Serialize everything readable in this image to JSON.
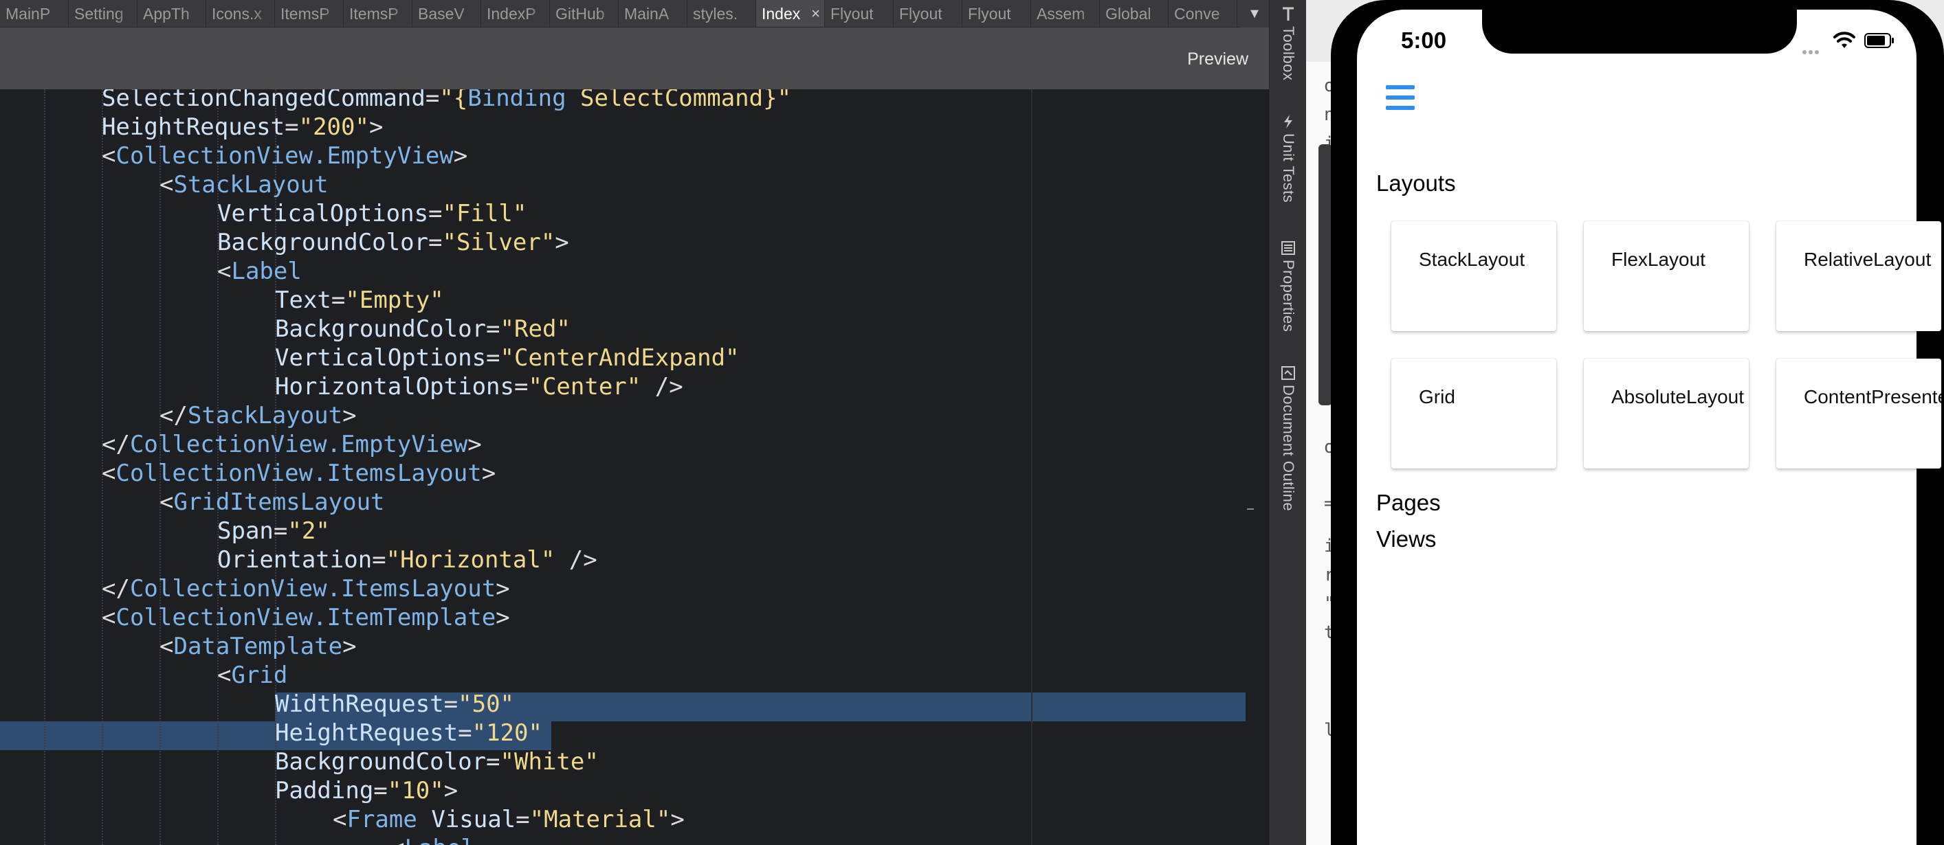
{
  "tabs": [
    {
      "label": "MainP",
      "active": false
    },
    {
      "label": "Setting",
      "active": false
    },
    {
      "label": "AppTh",
      "active": false
    },
    {
      "label": "Icons.x",
      "active": false
    },
    {
      "label": "ItemsP",
      "active": false
    },
    {
      "label": "ItemsP",
      "active": false
    },
    {
      "label": "BaseV",
      "active": false
    },
    {
      "label": "IndexP",
      "active": false
    },
    {
      "label": "GitHub",
      "active": false
    },
    {
      "label": "MainA",
      "active": false
    },
    {
      "label": "styles.",
      "active": false
    },
    {
      "label": "Index",
      "active": true
    },
    {
      "label": "Flyout",
      "active": false
    },
    {
      "label": "Flyout",
      "active": false
    },
    {
      "label": "Flyout",
      "active": false
    },
    {
      "label": "Assem",
      "active": false
    },
    {
      "label": "Global",
      "active": false
    },
    {
      "label": "Conve",
      "active": false
    }
  ],
  "tab_overflow_icon": "chevron-down-icon",
  "toolbar": {
    "preview_label": "Preview"
  },
  "code_lines": [
    [
      {
        "k": "a",
        "t": "SelectionChangedCommand"
      },
      {
        "k": "p",
        "t": "="
      },
      {
        "k": "s",
        "t": "\"{"
      },
      {
        "k": "t",
        "t": "Binding"
      },
      {
        "k": "s",
        "t": " SelectCommand}\""
      }
    ],
    [
      {
        "k": "a",
        "t": "HeightRequest"
      },
      {
        "k": "p",
        "t": "="
      },
      {
        "k": "s",
        "t": "\"200\""
      },
      {
        "k": "p",
        "t": ">"
      }
    ],
    [
      {
        "k": "p",
        "t": "<"
      },
      {
        "k": "t",
        "t": "CollectionView.EmptyView"
      },
      {
        "k": "p",
        "t": ">"
      }
    ],
    [
      {
        "k": "p",
        "t": "<"
      },
      {
        "k": "t",
        "t": "StackLayout"
      }
    ],
    [
      {
        "k": "a",
        "t": "VerticalOptions"
      },
      {
        "k": "p",
        "t": "="
      },
      {
        "k": "s",
        "t": "\"Fill\""
      }
    ],
    [
      {
        "k": "a",
        "t": "BackgroundColor"
      },
      {
        "k": "p",
        "t": "="
      },
      {
        "k": "s",
        "t": "\"Silver\""
      },
      {
        "k": "p",
        "t": ">"
      }
    ],
    [
      {
        "k": "p",
        "t": "<"
      },
      {
        "k": "t",
        "t": "Label"
      }
    ],
    [
      {
        "k": "a",
        "t": "Text"
      },
      {
        "k": "p",
        "t": "="
      },
      {
        "k": "s",
        "t": "\"Empty\""
      }
    ],
    [
      {
        "k": "a",
        "t": "BackgroundColor"
      },
      {
        "k": "p",
        "t": "="
      },
      {
        "k": "s",
        "t": "\"Red\""
      }
    ],
    [
      {
        "k": "a",
        "t": "VerticalOptions"
      },
      {
        "k": "p",
        "t": "="
      },
      {
        "k": "s",
        "t": "\"CenterAndExpand\""
      }
    ],
    [
      {
        "k": "a",
        "t": "HorizontalOptions"
      },
      {
        "k": "p",
        "t": "="
      },
      {
        "k": "s",
        "t": "\"Center\""
      },
      {
        "k": "p",
        "t": " />"
      }
    ],
    [
      {
        "k": "p",
        "t": "</"
      },
      {
        "k": "t",
        "t": "StackLayout"
      },
      {
        "k": "p",
        "t": ">"
      }
    ],
    [
      {
        "k": "p",
        "t": "</"
      },
      {
        "k": "t",
        "t": "CollectionView.EmptyView"
      },
      {
        "k": "p",
        "t": ">"
      }
    ],
    [
      {
        "k": "p",
        "t": "<"
      },
      {
        "k": "t",
        "t": "CollectionView.ItemsLayout"
      },
      {
        "k": "p",
        "t": ">"
      }
    ],
    [
      {
        "k": "p",
        "t": "<"
      },
      {
        "k": "t",
        "t": "GridItemsLayout"
      }
    ],
    [
      {
        "k": "a",
        "t": "Span"
      },
      {
        "k": "p",
        "t": "="
      },
      {
        "k": "s",
        "t": "\"2\""
      }
    ],
    [
      {
        "k": "a",
        "t": "Orientation"
      },
      {
        "k": "p",
        "t": "="
      },
      {
        "k": "s",
        "t": "\"Horizontal\""
      },
      {
        "k": "p",
        "t": " />"
      }
    ],
    [
      {
        "k": "p",
        "t": "</"
      },
      {
        "k": "t",
        "t": "CollectionView.ItemsLayout"
      },
      {
        "k": "p",
        "t": ">"
      }
    ],
    [
      {
        "k": "p",
        "t": "<"
      },
      {
        "k": "t",
        "t": "CollectionView.ItemTemplate"
      },
      {
        "k": "p",
        "t": ">"
      }
    ],
    [
      {
        "k": "p",
        "t": "<"
      },
      {
        "k": "t",
        "t": "DataTemplate"
      },
      {
        "k": "p",
        "t": ">"
      }
    ],
    [
      {
        "k": "p",
        "t": "<"
      },
      {
        "k": "t",
        "t": "Grid"
      }
    ],
    [
      {
        "k": "a",
        "t": "WidthRequest"
      },
      {
        "k": "p",
        "t": "="
      },
      {
        "k": "s",
        "t": "\"50\""
      }
    ],
    [
      {
        "k": "a",
        "t": "HeightRequest"
      },
      {
        "k": "p",
        "t": "="
      },
      {
        "k": "s",
        "t": "\"120\""
      }
    ],
    [
      {
        "k": "a",
        "t": "BackgroundColor"
      },
      {
        "k": "p",
        "t": "="
      },
      {
        "k": "s",
        "t": "\"White\""
      }
    ],
    [
      {
        "k": "a",
        "t": "Padding"
      },
      {
        "k": "p",
        "t": "="
      },
      {
        "k": "s",
        "t": "\"10\""
      },
      {
        "k": "p",
        "t": ">"
      }
    ],
    [
      {
        "k": "p",
        "t": "<"
      },
      {
        "k": "t",
        "t": "Frame"
      },
      {
        "k": "a",
        "t": " Visual"
      },
      {
        "k": "p",
        "t": "="
      },
      {
        "k": "s",
        "t": "\"Material\""
      },
      {
        "k": "p",
        "t": ">"
      }
    ],
    [
      {
        "k": "p",
        "t": "<"
      },
      {
        "k": "t",
        "t": "Label"
      }
    ]
  ],
  "side_pads": [
    {
      "label": "Toolbox",
      "icon": "toolbox-icon"
    },
    {
      "label": "Unit Tests",
      "icon": "lightning-icon"
    },
    {
      "label": "Properties",
      "icon": "properties-icon"
    },
    {
      "label": "Document Outline",
      "icon": "document-outline-icon"
    }
  ],
  "background_window": {
    "fragments": [
      "or",
      "ns",
      "io",
      "ew",
      "ut",
      "la",
      "nt",
      "zo",
      "ou",
      "at",
      "or",
      "=\"",
      "iz",
      "re",
      "\"{",
      "t=",
      "la"
    ]
  },
  "phone": {
    "status_time": "5:00",
    "menu_icon": "hamburger-menu-icon",
    "accent_color": "#2f8ef0",
    "sections": [
      {
        "title": "Layouts",
        "items": [
          "StackLayout",
          "FlexLayout",
          "RelativeLayout",
          "Grid",
          "AbsoluteLayout",
          "ContentPresenter"
        ]
      },
      {
        "title": "Pages"
      },
      {
        "title": "Views"
      }
    ]
  }
}
